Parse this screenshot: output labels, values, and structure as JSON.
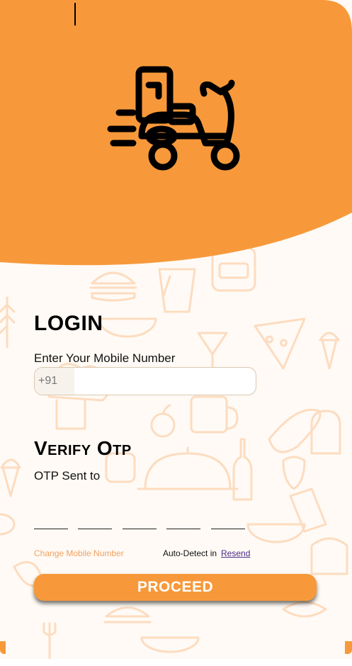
{
  "colors": {
    "accent": "#f7993a",
    "background": "#fffaf5",
    "pattern": "#fcdcc0"
  },
  "header": {
    "logo_icon": "delivery-scooter-icon"
  },
  "login": {
    "title": "LOGIN",
    "mobile_label": "Enter Your Mobile Number",
    "country_code": "+91",
    "mobile_value": ""
  },
  "verify": {
    "title": "Verify Otp",
    "sent_to": "OTP Sent to",
    "otp_digits": [
      "",
      "",
      "",
      "",
      ""
    ],
    "change_number": "Change Mobile Number",
    "auto_detect": "Auto-Detect in",
    "resend": "Resend"
  },
  "proceed_label": "PROCEED"
}
